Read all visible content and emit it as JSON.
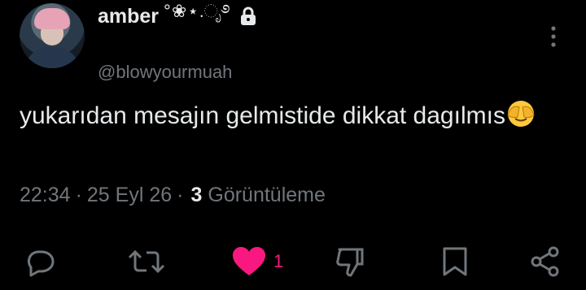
{
  "author": {
    "display_name": "amber",
    "name_decoration": "°❀⋆.ೃ࿔",
    "handle": "@blowyourmuah",
    "protected_icon": "lock-icon"
  },
  "tweet": {
    "text": "yukarıdan mesajın gelmistide dikkat dagılmıs",
    "emoji": "face-with-peeking-eye"
  },
  "meta": {
    "time": "22:34",
    "separator": "·",
    "date": "25 Eyl 26",
    "views_count": "3",
    "views_label": "Görüntüleme"
  },
  "actions": {
    "like_count": "1",
    "like_color": "#f91880",
    "icons": [
      "reply-icon",
      "retweet-icon",
      "like-icon",
      "dislike-icon",
      "bookmark-icon",
      "share-icon"
    ]
  },
  "colors": {
    "background": "#000000",
    "text": "#e7e9ea",
    "muted": "#71767b"
  }
}
